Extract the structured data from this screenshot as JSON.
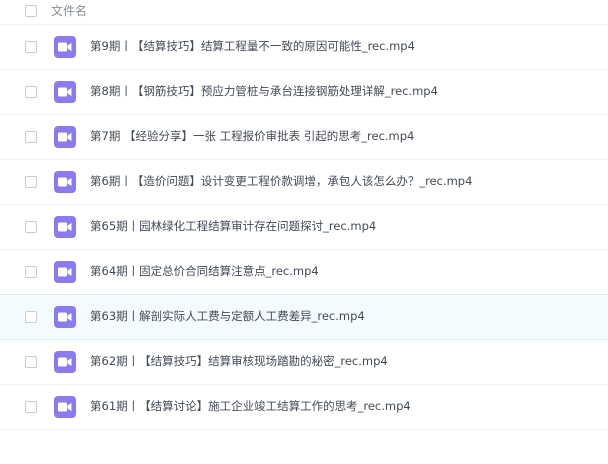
{
  "header": {
    "column_label": "文件名"
  },
  "files": [
    {
      "name": "第9期丨【结算技巧】结算工程量不一致的原因可能性_rec.mp4"
    },
    {
      "name": "第8期丨【钢筋技巧】预应力管桩与承台连接钢筋处理详解_rec.mp4"
    },
    {
      "name": "第7期 【经验分享】一张 工程报价审批表 引起的思考_rec.mp4"
    },
    {
      "name": "第6期丨【造价问题】设计变更工程价款调增，承包人该怎么办？_rec.mp4"
    },
    {
      "name": "第65期丨园林绿化工程结算审计存在问题探讨_rec.mp4"
    },
    {
      "name": "第64期丨固定总价合同结算注意点_rec.mp4"
    },
    {
      "name": "第63期丨解剖实际人工费与定额人工费差异_rec.mp4"
    },
    {
      "name": "第62期丨【结算技巧】结算审核现场踏勘的秘密_rec.mp4"
    },
    {
      "name": "第61期丨【结算讨论】施工企业竣工结算工作的思考_rec.mp4"
    }
  ],
  "colors": {
    "video_icon": "#8a7cf0",
    "hover_row": "#f4fbff"
  },
  "icons": {
    "file_type": "video-camera-icon"
  }
}
